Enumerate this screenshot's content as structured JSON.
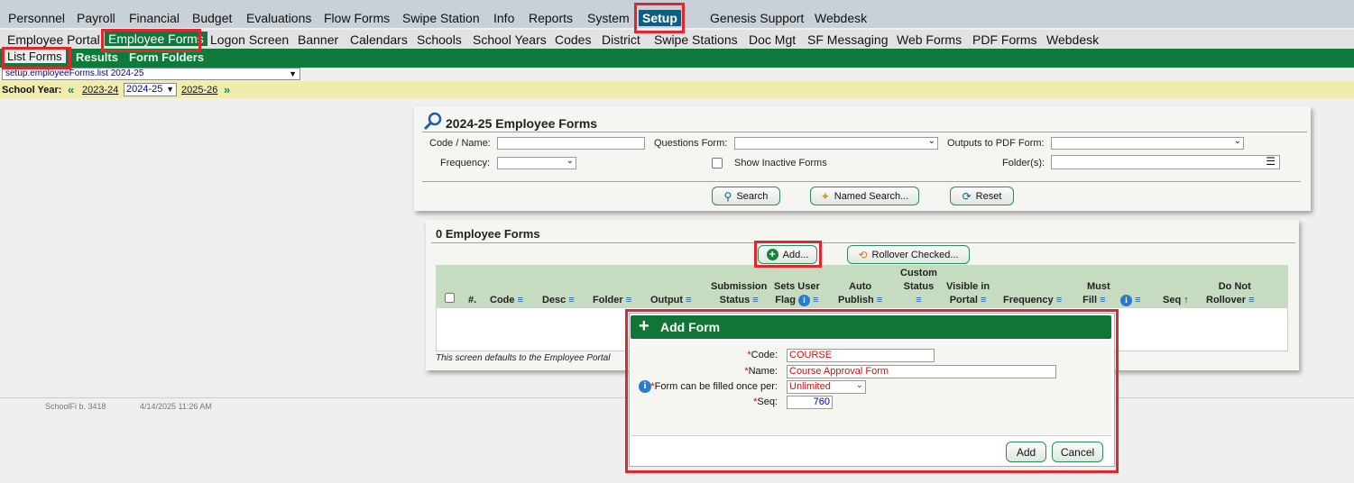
{
  "top_nav": {
    "items": [
      "Personnel",
      "Payroll",
      "Financial",
      "Budget",
      "Evaluations",
      "Flow Forms",
      "Swipe Station",
      "Info",
      "Reports",
      "System",
      "Setup",
      "Genesis Support",
      "Webdesk"
    ],
    "active": "Setup"
  },
  "sub_nav": {
    "items": [
      "Employee Portal",
      "Employee Forms",
      "Logon Screen",
      "Banner",
      "Calendars",
      "Schools",
      "School Years",
      "Codes",
      "District",
      "Swipe Stations",
      "Doc Mgt",
      "SF Messaging",
      "Web Forms",
      "PDF Forms",
      "Webdesk"
    ],
    "active": "Employee Forms"
  },
  "tabs": {
    "items": [
      "List Forms",
      "Results",
      "Form Folders"
    ],
    "active": "List Forms"
  },
  "path_select": {
    "value": "setup.employeeForms.list 2024-25"
  },
  "school_year": {
    "label": "School Year:",
    "prev": "2023-24",
    "current": "2024-25",
    "next": "2025-26"
  },
  "search_panel": {
    "title": "2024-25 Employee Forms",
    "code_name_label": "Code / Name:",
    "questions_form_label": "Questions Form:",
    "outputs_pdf_label": "Outputs to PDF Form:",
    "frequency_label": "Frequency:",
    "show_inactive_label": "Show Inactive Forms",
    "folders_label": "Folder(s):",
    "search_button": "Search",
    "named_search_button": "Named Search...",
    "reset_button": "Reset"
  },
  "results_panel": {
    "title": "0 Employee Forms",
    "add_button": "Add...",
    "rollover_button": "Rollover Checked...",
    "footnote": "This screen defaults to the Employee Portal"
  },
  "table": {
    "columns": {
      "num": "#.",
      "code": "Code",
      "desc": "Desc",
      "folder": "Folder",
      "output": "Output",
      "submission_1": "Submission",
      "submission_2": "Status",
      "sets_user_1": "Sets User",
      "sets_user_2": "Flag",
      "auto_1": "Auto",
      "auto_2": "Publish",
      "custom_1": "Custom",
      "custom_2": "Status",
      "visible_1": "Visible in",
      "visible_2": "Portal",
      "frequency": "Frequency",
      "must_1": "Must",
      "must_2": "Fill",
      "seq": "Seq",
      "dnr_1": "Do Not",
      "dnr_2": "Rollover"
    },
    "menu_glyph": "≡",
    "sort_glyph": "↑"
  },
  "footer": {
    "build": "SchoolFi b. 3418",
    "timestamp": "4/14/2025 11:26 AM"
  },
  "dialog": {
    "title": "Add Form",
    "code_label": "Code:",
    "code_value": "COURSE",
    "name_label": "Name:",
    "name_value": "Course Approval Form",
    "filled_label": "Form can be filled once per:",
    "filled_value": "Unlimited",
    "seq_label": "Seq:",
    "seq_value": "760",
    "add_button": "Add",
    "cancel_button": "Cancel"
  }
}
